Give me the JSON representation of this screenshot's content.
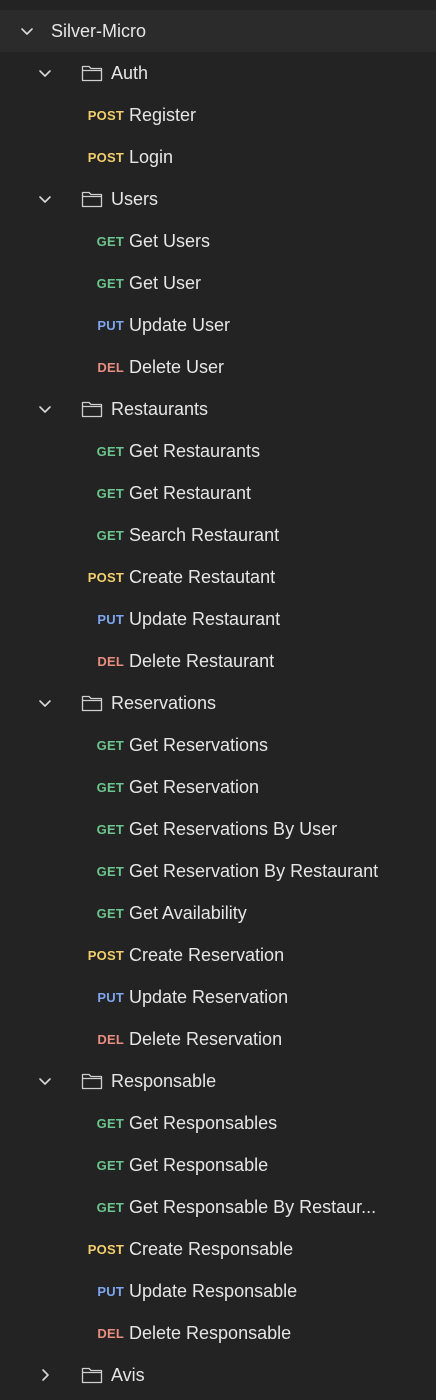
{
  "collection": {
    "name": "Silver-Micro",
    "expanded": true,
    "folders": [
      {
        "name": "Auth",
        "expanded": true,
        "requests": [
          {
            "method": "POST",
            "name": "Register"
          },
          {
            "method": "POST",
            "name": "Login"
          }
        ]
      },
      {
        "name": "Users",
        "expanded": true,
        "requests": [
          {
            "method": "GET",
            "name": "Get Users"
          },
          {
            "method": "GET",
            "name": "Get User"
          },
          {
            "method": "PUT",
            "name": "Update User"
          },
          {
            "method": "DEL",
            "name": "Delete User"
          }
        ]
      },
      {
        "name": "Restaurants",
        "expanded": true,
        "requests": [
          {
            "method": "GET",
            "name": "Get Restaurants"
          },
          {
            "method": "GET",
            "name": "Get Restaurant"
          },
          {
            "method": "GET",
            "name": "Search Restaurant"
          },
          {
            "method": "POST",
            "name": "Create Restautant"
          },
          {
            "method": "PUT",
            "name": "Update Restaurant"
          },
          {
            "method": "DEL",
            "name": "Delete Restaurant"
          }
        ]
      },
      {
        "name": "Reservations",
        "expanded": true,
        "requests": [
          {
            "method": "GET",
            "name": "Get Reservations"
          },
          {
            "method": "GET",
            "name": "Get Reservation"
          },
          {
            "method": "GET",
            "name": "Get Reservations By User"
          },
          {
            "method": "GET",
            "name": "Get Reservation By Restaurant"
          },
          {
            "method": "GET",
            "name": "Get Availability"
          },
          {
            "method": "POST",
            "name": "Create Reservation"
          },
          {
            "method": "PUT",
            "name": "Update Reservation"
          },
          {
            "method": "DEL",
            "name": "Delete Reservation"
          }
        ]
      },
      {
        "name": "Responsable",
        "expanded": true,
        "requests": [
          {
            "method": "GET",
            "name": "Get Responsables"
          },
          {
            "method": "GET",
            "name": "Get Responsable"
          },
          {
            "method": "GET",
            "name": "Get Responsable By Restaur..."
          },
          {
            "method": "POST",
            "name": "Create Responsable"
          },
          {
            "method": "PUT",
            "name": "Update Responsable"
          },
          {
            "method": "DEL",
            "name": "Delete Responsable"
          }
        ]
      },
      {
        "name": "Avis",
        "expanded": false,
        "requests": []
      }
    ]
  },
  "icons": {
    "expanded": "chevron-down-icon",
    "collapsed": "chevron-right-icon",
    "folder": "folder-icon"
  },
  "method_colors": {
    "GET": "#6cc48e",
    "POST": "#f3cf6b",
    "PUT": "#7ea6f0",
    "DEL": "#e98d80"
  }
}
